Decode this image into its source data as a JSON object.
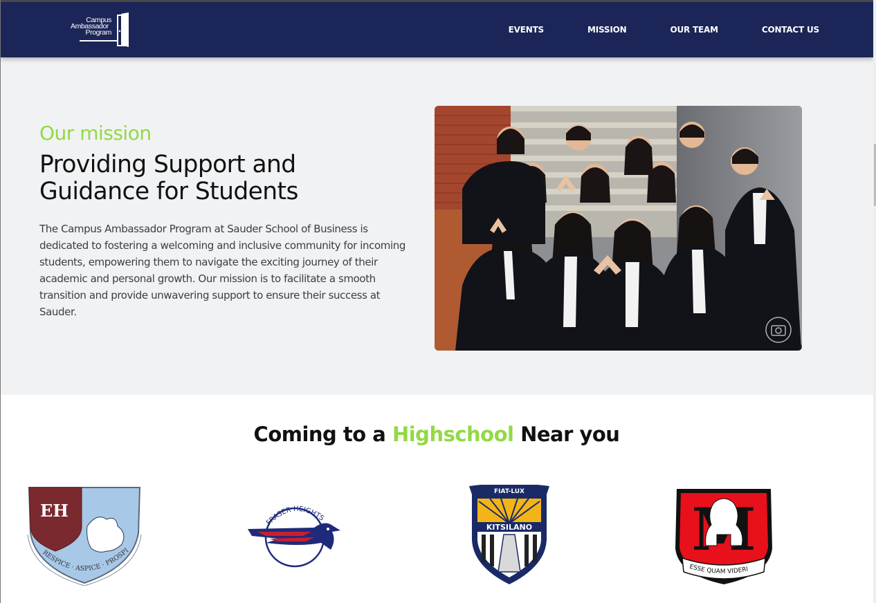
{
  "header": {
    "logo": {
      "line1": "Campus",
      "line2": "Ambassador",
      "line3": "Program"
    },
    "nav": [
      {
        "label": "EVENTS"
      },
      {
        "label": "MISSION"
      },
      {
        "label": "OUR TEAM"
      },
      {
        "label": "CONTACT US"
      }
    ]
  },
  "mission": {
    "kicker": "Our mission",
    "headline": "Providing Support and Guidance for Students",
    "body": "The Campus Ambassador Program at Sauder School of Business is dedicated to fostering a welcoming and inclusive community for incoming students, empowering them to navigate the exciting journey of their academic and personal growth. Our mission is to facilitate a smooth transition and provide unwavering support to ensure their success at Sauder.",
    "photo_icon": "camera-watermark-icon"
  },
  "schools": {
    "title_pre": "Coming to a ",
    "title_highlight": "Highschool",
    "title_post": " Near you",
    "crests": [
      {
        "monogram": "EH",
        "motto": "RESPICE · ASPICE · PROSPICE",
        "colors": {
          "shield": "#a8c8e8",
          "field": "#7a2a2e"
        }
      },
      {
        "arc_text": "FRASER HEIGHTS",
        "colors": {
          "blue": "#1f2b7a",
          "red": "#c8202e"
        }
      },
      {
        "banner": "FIAT-LUX",
        "name": "KITSILANO",
        "colors": {
          "navy": "#1a2a66",
          "gold": "#f2b417"
        }
      },
      {
        "monogram": "M",
        "motto": "ESSE QUAM VIDERI",
        "colors": {
          "red": "#e8101b",
          "black": "#111111"
        }
      }
    ]
  },
  "colors": {
    "nav_bg": "#1b2557",
    "accent": "#92d944",
    "section_bg": "#f1f2f4"
  }
}
